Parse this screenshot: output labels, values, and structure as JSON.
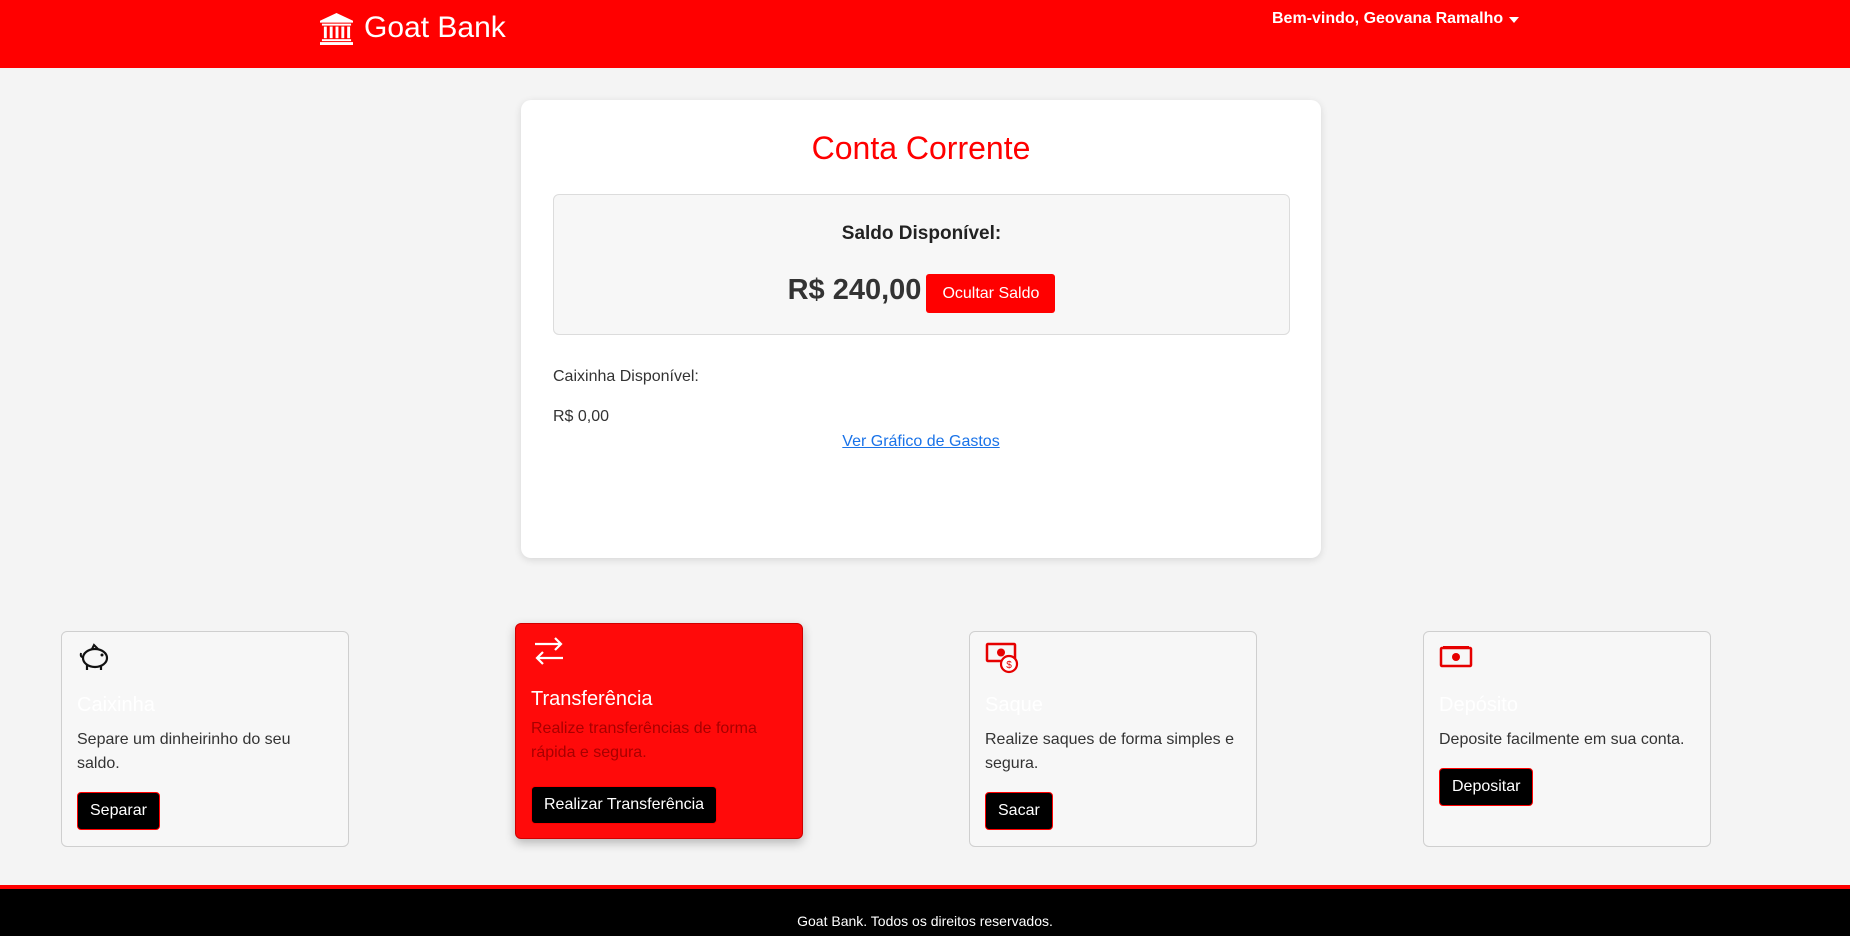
{
  "header": {
    "brand_name": "Goat Bank",
    "brand_icon": "bank-icon",
    "welcome": "Bem-vindo, Geovana Ramalho"
  },
  "account": {
    "title": "Conta Corrente",
    "balance_label": "Saldo Disponível:",
    "balance_value": "R$ 240,00",
    "hide_balance_label": "Ocultar Saldo",
    "caixinha_label": "Caixinha Disponível:",
    "caixinha_value": "R$ 0,00",
    "chart_link": "Ver Gráfico de Gastos"
  },
  "services": [
    {
      "title": "Caixinha",
      "description": "Separe um dinheirinho do seu saldo.",
      "button": "Separar",
      "icon": "piggy-bank-icon"
    },
    {
      "title": "Transferência",
      "description": "Realize transferências de forma rápida e segura.",
      "button": "Realizar Transferência",
      "icon": "transfer-arrows-icon"
    },
    {
      "title": "Saque",
      "description": "Realize saques de forma simples e segura.",
      "button": "Sacar",
      "icon": "money-withdraw-icon"
    },
    {
      "title": "Depósito",
      "description": "Deposite facilmente em sua conta.",
      "button": "Depositar",
      "icon": "money-bill-icon"
    }
  ],
  "footer": {
    "text": "Goat Bank. Todos os direitos reservados."
  },
  "colors": {
    "primary": "#ff0000",
    "active_card": "#ff0a0a",
    "button_dark": "#000000",
    "link": "#1a73e8"
  }
}
